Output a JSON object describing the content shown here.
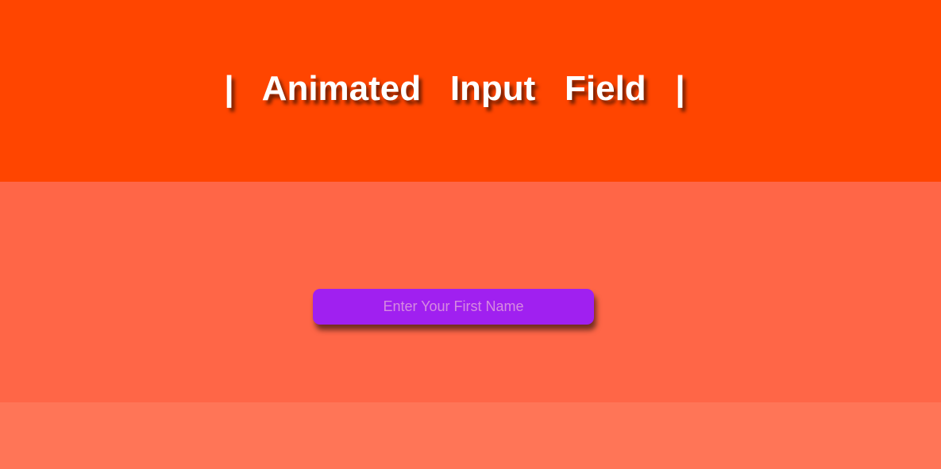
{
  "header": {
    "title": "|   Animated   Input   Field   |"
  },
  "form": {
    "first_name": {
      "placeholder": "Enter Your First Name",
      "value": ""
    }
  },
  "colors": {
    "top_band": "#ff4500",
    "middle_band": "#ff6647",
    "bottom_band": "#ff7557",
    "input_background": "#a020f0",
    "input_placeholder": "#d68ae0",
    "title_text": "#ffffff"
  }
}
